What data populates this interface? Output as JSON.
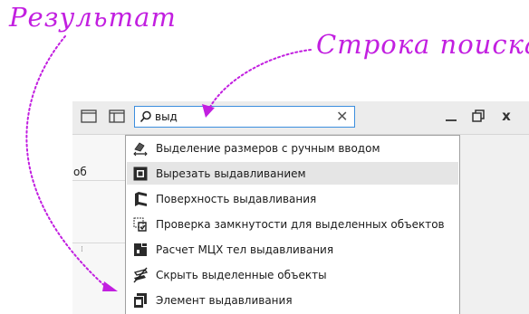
{
  "annotations": {
    "result_label": "Результат",
    "search_label": "Строка поиска",
    "accent_color": "#c21fe0"
  },
  "search": {
    "value": "выд",
    "icon": "magnifier-icon",
    "clear_icon": "close-icon"
  },
  "window_controls": {
    "minimize_icon": "minimize-icon",
    "restore_icon": "restore-icon",
    "close_label": "x"
  },
  "sidebar": {
    "partial_text": "об"
  },
  "results": [
    {
      "label": "Выделение размеров с ручным вводом",
      "icon": "dimension-select-icon"
    },
    {
      "label": "Вырезать выдавливанием",
      "icon": "cut-extrude-icon",
      "selected": true
    },
    {
      "label": "Поверхность выдавливания",
      "icon": "extrude-surface-icon"
    },
    {
      "label": "Проверка замкнутости для выделенных объектов",
      "icon": "closure-check-icon"
    },
    {
      "label": "Расчет МЦХ тел выдавливания",
      "icon": "mass-properties-icon"
    },
    {
      "label": "Скрыть выделенные объекты",
      "icon": "hide-objects-icon"
    },
    {
      "label": "Элемент выдавливания",
      "icon": "extrude-element-icon"
    }
  ]
}
